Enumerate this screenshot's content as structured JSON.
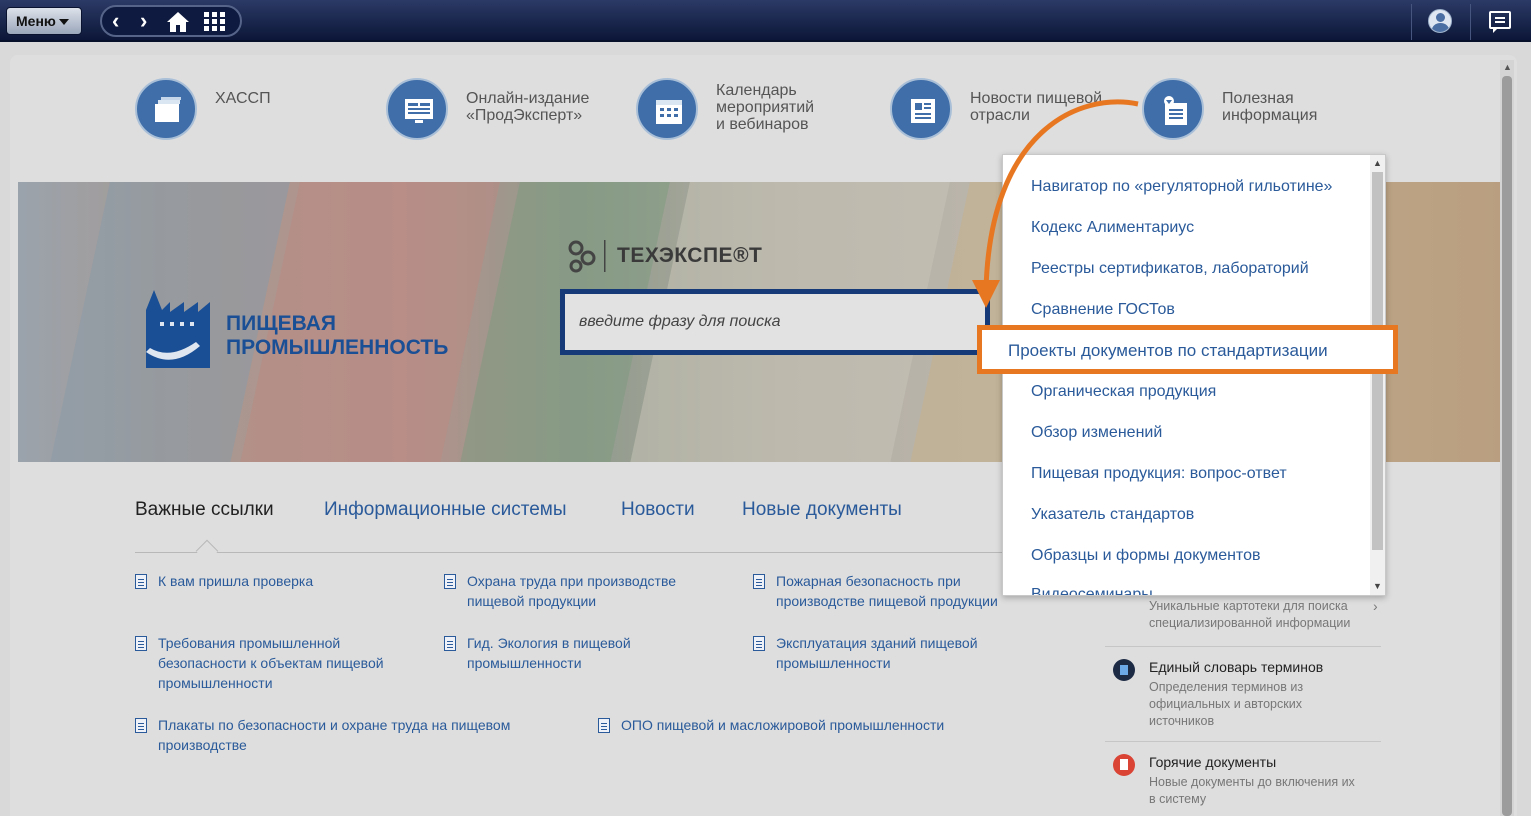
{
  "topbar": {
    "menu_label": "Меню"
  },
  "categories": [
    {
      "label": "ХАССП",
      "icon": "folders-icon"
    },
    {
      "label": "Онлайн-издание\n«ПродЭксперт»",
      "icon": "monitor-icon"
    },
    {
      "label": "Календарь\nмероприятий\nи вебинаров",
      "icon": "calendar-icon"
    },
    {
      "label": "Новости пищевой\nотрасли",
      "icon": "newspaper-icon"
    },
    {
      "label": "Полезная\nинформация",
      "icon": "info-doc-icon"
    }
  ],
  "banner": {
    "brand": "ПИЩЕВАЯ\nПРОМЫШЛЕННОСТЬ",
    "tex_brand": "ТЕХЭКСПЕ®Т",
    "search_placeholder": "введите фразу для поиска"
  },
  "tabs": [
    {
      "label": "Важные ссылки",
      "active": true
    },
    {
      "label": "Информационные системы",
      "active": false
    },
    {
      "label": "Новости",
      "active": false
    },
    {
      "label": "Новые документы",
      "active": false
    }
  ],
  "links": [
    "К вам пришла проверка",
    "Охрана труда при производстве\nпищевой продукции",
    "Пожарная безопасность при\nпроизводстве пищевой продукции",
    "Требования промышленной\nбезопасности к объектам пищевой\nпромышленности",
    "Гид. Экология в пищевой\nпромышленности",
    "Эксплуатация зданий пищевой\nпромышленности",
    "Плакаты по безопасности и охране труда на пищевом\nпроизводстве",
    "ОПО пищевой и масложировой промышленности"
  ],
  "side": [
    {
      "title": "",
      "desc": "Уникальные картотеки для поиска\nспециализированной информации"
    },
    {
      "title": "Единый словарь терминов",
      "desc": "Определения терминов из\nофициальных и авторских\nисточников"
    },
    {
      "title": "Горячие документы",
      "desc": "Новые документы до включения их\nв систему"
    }
  ],
  "dropdown": {
    "items": [
      "Навигатор по «регуляторной гильотине»",
      "Кодекс Алиментариус",
      "Реестры сертификатов, лабораторий",
      "Сравнение ГОСТов",
      "Проекты документов по стандартизации",
      "Органическая продукция",
      "Обзор изменений",
      "Пищевая продукция: вопрос-ответ",
      "Указатель стандартов",
      "Образцы и формы документов",
      "Видеосеминары"
    ]
  },
  "colors": {
    "accent": "#2a5a9a",
    "highlight": "#e87722",
    "topbar": "#0c1638"
  }
}
